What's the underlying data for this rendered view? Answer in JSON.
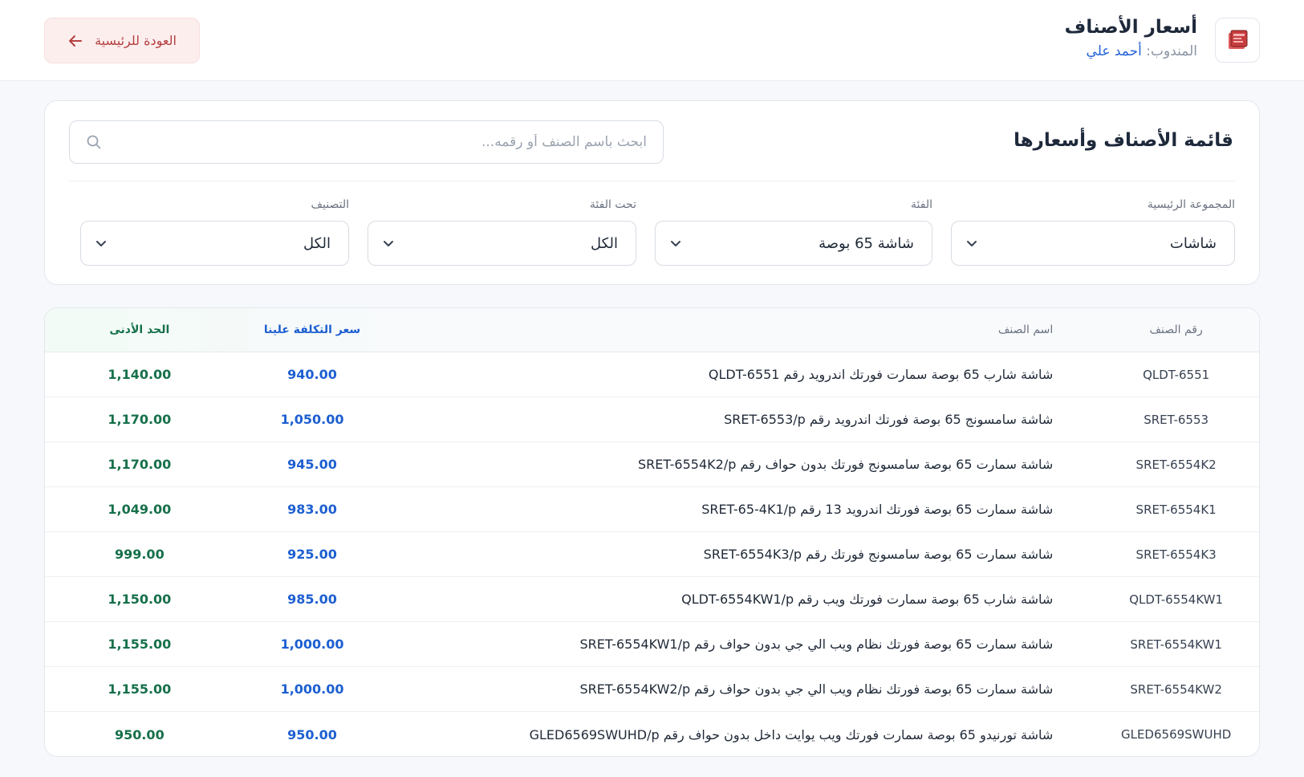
{
  "header": {
    "title": "أسعار الأصناف",
    "rep_label": "المندوب:",
    "rep_name": "أحمد علي",
    "back_label": "العودة للرئيسية"
  },
  "filters": {
    "title": "قائمة الأصناف وأسعارها",
    "search_placeholder": "ابحث باسم الصنف أو رقمه...",
    "main_group": {
      "label": "المجموعة الرئيسية",
      "value": "شاشات"
    },
    "category": {
      "label": "الفئة",
      "value": "شاشة 65 بوصة"
    },
    "subcategory": {
      "label": "تحت الفئة",
      "value": "الكل"
    },
    "classification": {
      "label": "التصنيف",
      "value": "الكل"
    }
  },
  "table": {
    "headers": {
      "code": "رقم الصنف",
      "name": "اسم الصنف",
      "cost": "سعر التكلفة علينا",
      "min": "الحد الأدنى"
    },
    "rows": [
      {
        "code": "QLDT-6551",
        "name": "شاشة شارب 65 بوصة سمارت فورتك اندرويد رقم QLDT-6551",
        "cost": "940.00",
        "min": "1,140.00"
      },
      {
        "code": "SRET-6553",
        "name": "شاشة سامسونج 65 بوصة فورتك اندرويد رقم SRET-6553/p",
        "cost": "1,050.00",
        "min": "1,170.00"
      },
      {
        "code": "SRET-6554K2",
        "name": "شاشة سمارت 65 بوصة سامسونج فورتك بدون حواف رقم SRET-6554K2/p",
        "cost": "945.00",
        "min": "1,170.00"
      },
      {
        "code": "SRET-6554K1",
        "name": "شاشة سمارت 65 بوصة فورتك اندرويد 13 رقم SRET-65-4K1/p",
        "cost": "983.00",
        "min": "1,049.00"
      },
      {
        "code": "SRET-6554K3",
        "name": "شاشة سمارت 65 بوصة سامسونج فورتك رقم SRET-6554K3/p",
        "cost": "925.00",
        "min": "999.00"
      },
      {
        "code": "QLDT-6554KW1",
        "name": "شاشة شارب 65 بوصة سمارت فورتك ويب رقم QLDT-6554KW1/p",
        "cost": "985.00",
        "min": "1,150.00"
      },
      {
        "code": "SRET-6554KW1",
        "name": "شاشة سمارت 65 بوصة فورتك نظام ويب الي جي بدون حواف رقم SRET-6554KW1/p",
        "cost": "1,000.00",
        "min": "1,155.00"
      },
      {
        "code": "SRET-6554KW2",
        "name": "شاشة سمارت 65 بوصة فورتك نظام ويب الي جي بدون حواف رقم SRET-6554KW2/p",
        "cost": "1,000.00",
        "min": "1,155.00"
      },
      {
        "code": "GLED6569SWUHD",
        "name": "شاشة تورنيدو 65 بوصة سمارت فورتك ويب يوايت داخل بدون حواف رقم GLED6569SWUHD/p",
        "cost": "950.00",
        "min": "950.00"
      }
    ]
  }
}
